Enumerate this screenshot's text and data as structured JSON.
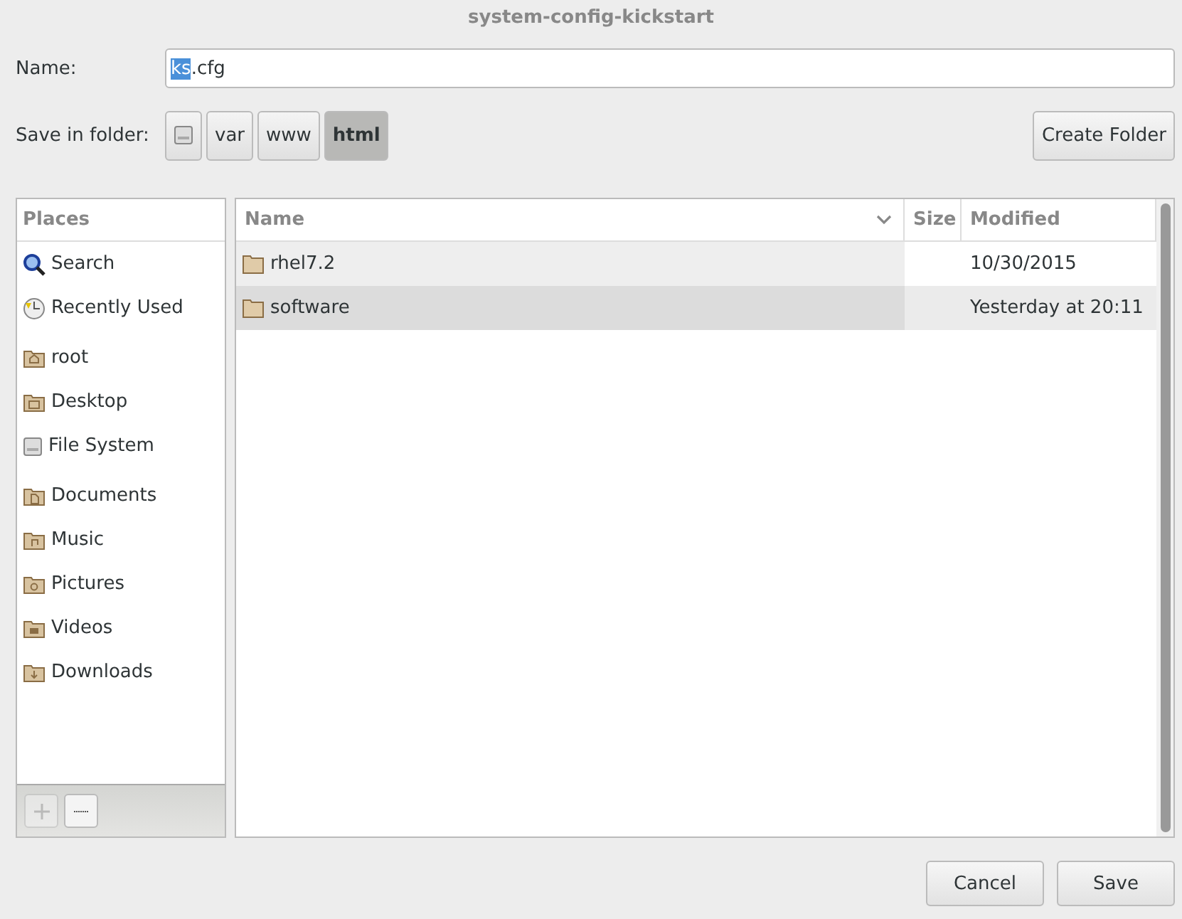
{
  "window": {
    "title": "system-config-kickstart"
  },
  "name_field": {
    "label": "Name:",
    "value": [
      {
        "text": "ks",
        "selected": true
      },
      {
        "text": ".cfg",
        "selected": false
      }
    ]
  },
  "folder_bar": {
    "label": "Save in folder:",
    "path": [
      {
        "kind": "drive",
        "selected": false
      },
      {
        "label": "var",
        "selected": false
      },
      {
        "label": "www",
        "selected": false
      },
      {
        "label": "html",
        "selected": true
      }
    ],
    "create_button": "Create Folder"
  },
  "places": {
    "header": "Places",
    "groups": [
      [
        {
          "label": "Search",
          "kind": "search"
        },
        {
          "label": "Recently Used",
          "kind": "recent"
        }
      ],
      [
        {
          "label": "root",
          "kind": "home"
        },
        {
          "label": "Desktop",
          "kind": "desktop"
        },
        {
          "label": "File System",
          "kind": "drive"
        }
      ],
      [
        {
          "label": "Documents",
          "kind": "documents"
        },
        {
          "label": "Music",
          "kind": "music"
        },
        {
          "label": "Pictures",
          "kind": "pictures"
        },
        {
          "label": "Videos",
          "kind": "videos"
        },
        {
          "label": "Downloads",
          "kind": "downloads"
        }
      ]
    ],
    "add_disabled": true,
    "remove_disabled": false
  },
  "files": {
    "columns": [
      "Name",
      "Size",
      "Modified"
    ],
    "rows": [
      {
        "name": "rhel7.2",
        "modified": "10/30/2015",
        "highlighted": false
      },
      {
        "name": "software",
        "modified": "Yesterday at 20:11",
        "highlighted": true
      }
    ]
  },
  "buttons": [
    "Cancel",
    "Save"
  ]
}
